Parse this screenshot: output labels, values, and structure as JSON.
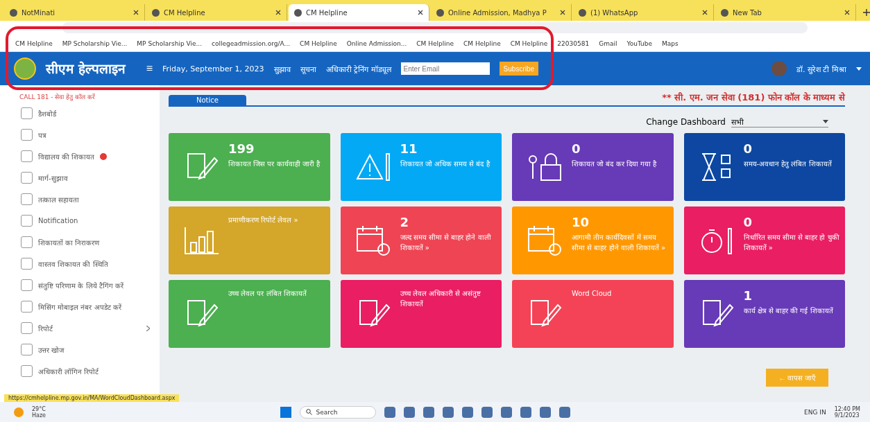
{
  "browser": {
    "tabs": [
      {
        "label": "NotMinati",
        "selected": false
      },
      {
        "label": "CM Helpline",
        "selected": false
      },
      {
        "label": "CM Helpline",
        "selected": true
      },
      {
        "label": "Online Admission, Madhya P",
        "selected": false
      },
      {
        "label": "(1) WhatsApp",
        "selected": false
      },
      {
        "label": "New Tab",
        "selected": false
      }
    ],
    "bookmarks": [
      "CM Helpline",
      "MP Scholarship Vie...",
      "MP Scholarship Vie...",
      "collegeadmission.org/A...",
      "CM Helpline",
      "Online Admission...",
      "CM Helpline",
      "CM Helpline",
      "CM Helpline",
      "22030581",
      "Gmail",
      "YouTube",
      "Maps"
    ]
  },
  "highlight_box": true,
  "header": {
    "logo": "सीएम हेल्पलाइन",
    "menu_icon": "≡",
    "date": "Friday, September 1, 2023",
    "links": [
      "सुझाव",
      "सूचना",
      "अधिकारी ट्रेनिंग मॉड्यूल"
    ],
    "email": {
      "placeholder": "Enter Email"
    },
    "subscribe": "Subscribe",
    "user": "डॉ. सुरेश टी मिश्रा"
  },
  "call_line": "CALL 181 - सेवा हेतु कॉल करें",
  "notice_tab": "Notice",
  "marquee": "** सी. एम. जन सेवा (181) फोन कॉल के माध्यम से",
  "change_dashboard": {
    "label": "Change Dashboard",
    "value": "सभी"
  },
  "sidebar": {
    "items": [
      {
        "label": "डैशबोर्ड",
        "alert": false,
        "expandable": false
      },
      {
        "label": "पत्र",
        "alert": false,
        "expandable": false
      },
      {
        "label": "विद्यालय की शिकायत",
        "alert": true,
        "expandable": false
      },
      {
        "label": "मार्ग-सुझाव",
        "alert": false,
        "expandable": false
      },
      {
        "label": "तत्काल सहायता",
        "alert": false,
        "expandable": false
      },
      {
        "label": "Notification",
        "alert": false,
        "expandable": false
      },
      {
        "label": "शिकायतों का निराकरण",
        "alert": false,
        "expandable": false
      },
      {
        "label": "वास्तव शिकायत की स्थिति",
        "alert": false,
        "expandable": false
      },
      {
        "label": "संतुष्टि परिणाम के लिये टैगिंग करें",
        "alert": false,
        "expandable": false
      },
      {
        "label": "मिसिंग मोबाइल नंबर अपडेट करें",
        "alert": false,
        "expandable": false
      },
      {
        "label": "रिपोर्ट",
        "alert": false,
        "expandable": true
      },
      {
        "label": "उत्तर खोज",
        "alert": false,
        "expandable": false
      },
      {
        "label": "अधिकारी लॉगिन रिपोर्ट",
        "alert": false,
        "expandable": false
      }
    ]
  },
  "cards": [
    {
      "count": "199",
      "text": "शिकायत जिस पर कार्यवाही जारी है",
      "color": "#4caf50"
    },
    {
      "count": "11",
      "text": "शिकायत जो अधिक समय से बंद है",
      "color": "#03a9f4"
    },
    {
      "count": "0",
      "text": "शिकायत जो बंद कर दिया गया है",
      "color": "#673ab7"
    },
    {
      "count": "0",
      "text": "समय-अवधान हेतु लंबित शिकायतें",
      "color": "#0d47a1"
    },
    {
      "text": "प्रमाणीकरण रिपोर्ट लेवल »",
      "color": "#d4a62a"
    },
    {
      "count": "2",
      "text": "जल्द समय सीमा से बाहर होने वाली शिकायतें »",
      "color": "#ef4453"
    },
    {
      "count": "10",
      "text": "आगामी तीन कार्यदिवसों में समय सीमा से बाहर होने वाली शिकायतें »",
      "color": "#ff9800"
    },
    {
      "count": "0",
      "text": "निर्धारित समय सीमा से बाहर हो चुकी शिकायतें »",
      "color": "#e91e63"
    },
    {
      "text": "उच्च लेवल पर लंबित शिकायतें",
      "color": "#4caf50"
    },
    {
      "text": "उच्च लेवल अधिकारी से असंतुष्ट शिकायतें",
      "color": "#e91e63"
    },
    {
      "text": "Word Cloud",
      "color": "#f44356"
    },
    {
      "count": "1",
      "text": "कार्य क्षेत्र से बाहर की गई शिकायतें",
      "color": "#673ab7"
    }
  ],
  "back_button": "← वापस जाएँ",
  "status_url": "https://cmhelpline.mp.gov.in/MA/WordCloudDashboard.aspx",
  "taskbar": {
    "weather": "29°C",
    "weather_note": "Haze",
    "search": {
      "placeholder": "Search"
    },
    "lang": "ENG IN",
    "time": "12:40 PM",
    "date": "9/1/2023"
  }
}
